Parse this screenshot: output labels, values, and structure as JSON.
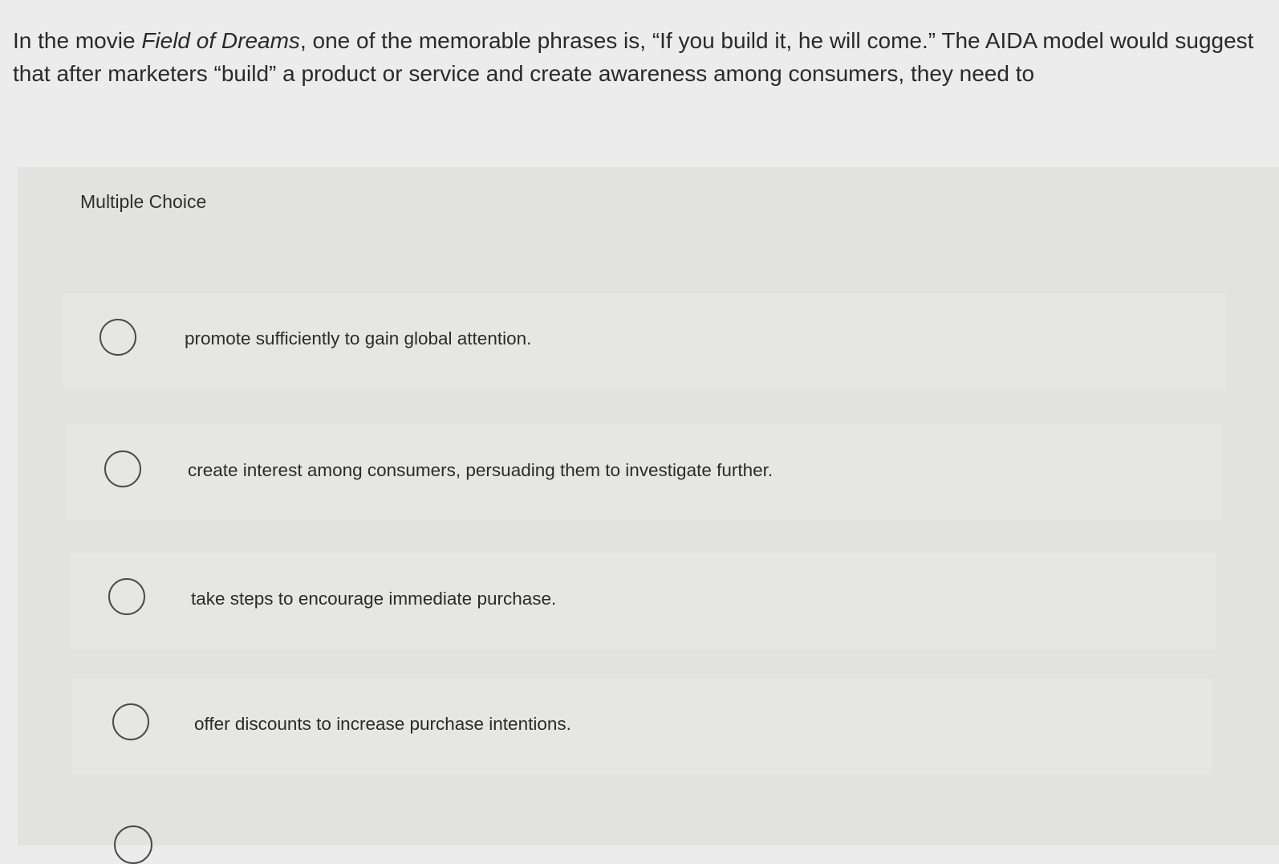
{
  "question": {
    "text_before": "In the movie ",
    "movie_title": "Field of Dreams",
    "text_after": ", one of the memorable phrases is, “If you build it, he will come.” The AIDA model would suggest that after marketers “build” a product or service and create awareness among consumers, they need to"
  },
  "panel": {
    "label": "Multiple Choice"
  },
  "options": [
    {
      "label": "promote sufficiently to gain global attention.",
      "selected": false
    },
    {
      "label": "create interest among consumers, persuading them to investigate further.",
      "selected": false
    },
    {
      "label": "take steps to encourage immediate purchase.",
      "selected": false
    },
    {
      "label": "offer discounts to increase purchase intentions.",
      "selected": false
    }
  ]
}
